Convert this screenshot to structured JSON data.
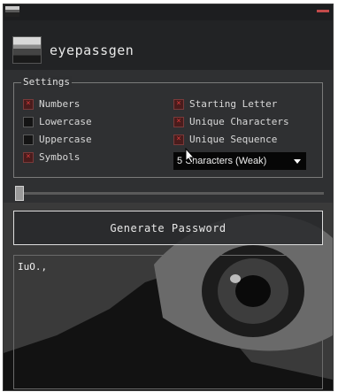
{
  "app": {
    "title": "eyepassgen"
  },
  "settings": {
    "legend": "Settings",
    "left_options": [
      {
        "label": "Numbers",
        "checked": true
      },
      {
        "label": "Lowercase",
        "checked": false
      },
      {
        "label": "Uppercase",
        "checked": false
      },
      {
        "label": "Symbols",
        "checked": true
      }
    ],
    "right_options": [
      {
        "label": "Starting Letter",
        "checked": true
      },
      {
        "label": "Unique Characters",
        "checked": true
      },
      {
        "label": "Unique Sequence",
        "checked": true
      }
    ],
    "length_select": {
      "value": "5 Characters (Weak)"
    }
  },
  "slider": {
    "value": 0
  },
  "generate_button": {
    "label": "Generate Password"
  },
  "output": {
    "text": "IuO.,"
  },
  "colors": {
    "window_bg": "#222325",
    "accent_red": "#c24a4a",
    "select_bg": "#060606"
  },
  "icons": {
    "checkbox_mark": "×",
    "dropdown": "chevron-down-icon",
    "close": "close-icon"
  }
}
